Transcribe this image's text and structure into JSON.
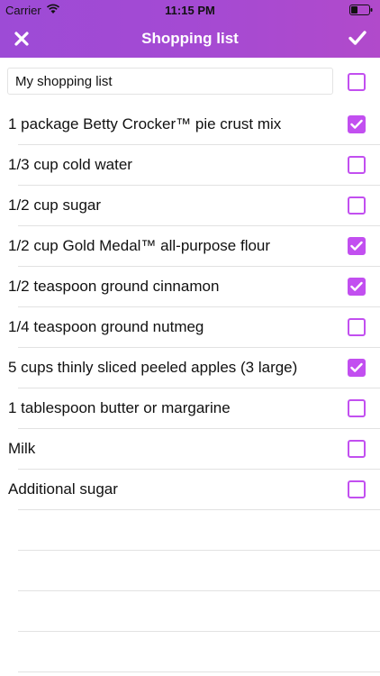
{
  "status_bar": {
    "carrier": "Carrier",
    "time": "11:15 PM"
  },
  "nav": {
    "title": "Shopping list",
    "close_icon": "close-icon",
    "done_icon": "checkmark-icon"
  },
  "list_name": {
    "value": "My shopping list",
    "checked": false
  },
  "items": [
    {
      "label": "1 package Betty Crocker™ pie crust mix",
      "checked": true
    },
    {
      "label": "1/3 cup cold water",
      "checked": false
    },
    {
      "label": "1/2 cup sugar",
      "checked": false
    },
    {
      "label": "1/2 cup Gold Medal™ all-purpose flour",
      "checked": true
    },
    {
      "label": "1/2 teaspoon ground cinnamon",
      "checked": true
    },
    {
      "label": "1/4 teaspoon ground nutmeg",
      "checked": false
    },
    {
      "label": "5 cups thinly sliced peeled apples (3 large)",
      "checked": true
    },
    {
      "label": "1 tablespoon butter or margarine",
      "checked": false
    },
    {
      "label": "Milk",
      "checked": false
    },
    {
      "label": "Additional sugar",
      "checked": false
    }
  ],
  "colors": {
    "accent": "#c24ff0",
    "header_start": "#9d4bd6",
    "header_end": "#b14acb"
  }
}
